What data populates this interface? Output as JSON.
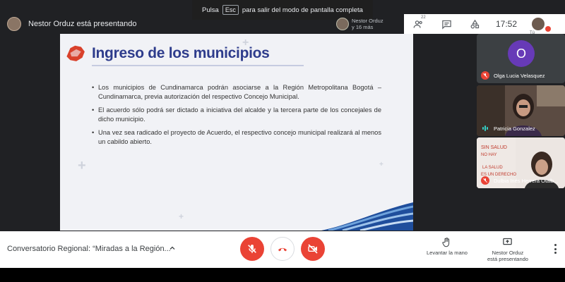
{
  "presenter_bar": {
    "text": "Nestor Orduz está presentando"
  },
  "fullscreen_toast": {
    "prefix": "Pulsa",
    "key": "Esc",
    "suffix": "para salir del modo de pantalla completa"
  },
  "overlay": {
    "name": "Nestor Orduz",
    "more": "y 16 más"
  },
  "top_bar": {
    "participants_count": "22",
    "clock": "17:52",
    "self_label": "Tú"
  },
  "slide": {
    "title": "Ingreso de los municipios",
    "bullets": [
      "Los municipios de Cundinamarca podrán asociarse a la Región Metropolitana Bogotá – Cundinamarca, previa autorización del respectivo Concejo Municipal.",
      "El acuerdo sólo podrá ser dictado a iniciativa del alcalde y la tercera parte de los concejales de dicho municipio.",
      "Una vez sea radicado el proyecto de Acuerdo, el respectivo concejo municipal realizará al menos un cabildo abierto."
    ]
  },
  "participants": [
    {
      "name": "Olga Lucia Velasquez",
      "initial": "O",
      "muted": true
    },
    {
      "name": "Patricia Gonzalez",
      "muted": false
    },
    {
      "name": "Dulbia Inés Herrera Otalb...",
      "muted": true
    }
  ],
  "bottom_bar": {
    "meeting_title": "Conversatorio Regional: “Miradas a la Región...",
    "raise_hand_label": "Levantar la mano",
    "present_label_1": "Nestor Orduz",
    "present_label_2": "está presentando"
  },
  "colors": {
    "accent_red": "#ea4335",
    "slide_title": "#2e3c8c",
    "avatar_purple": "#673ab7"
  }
}
